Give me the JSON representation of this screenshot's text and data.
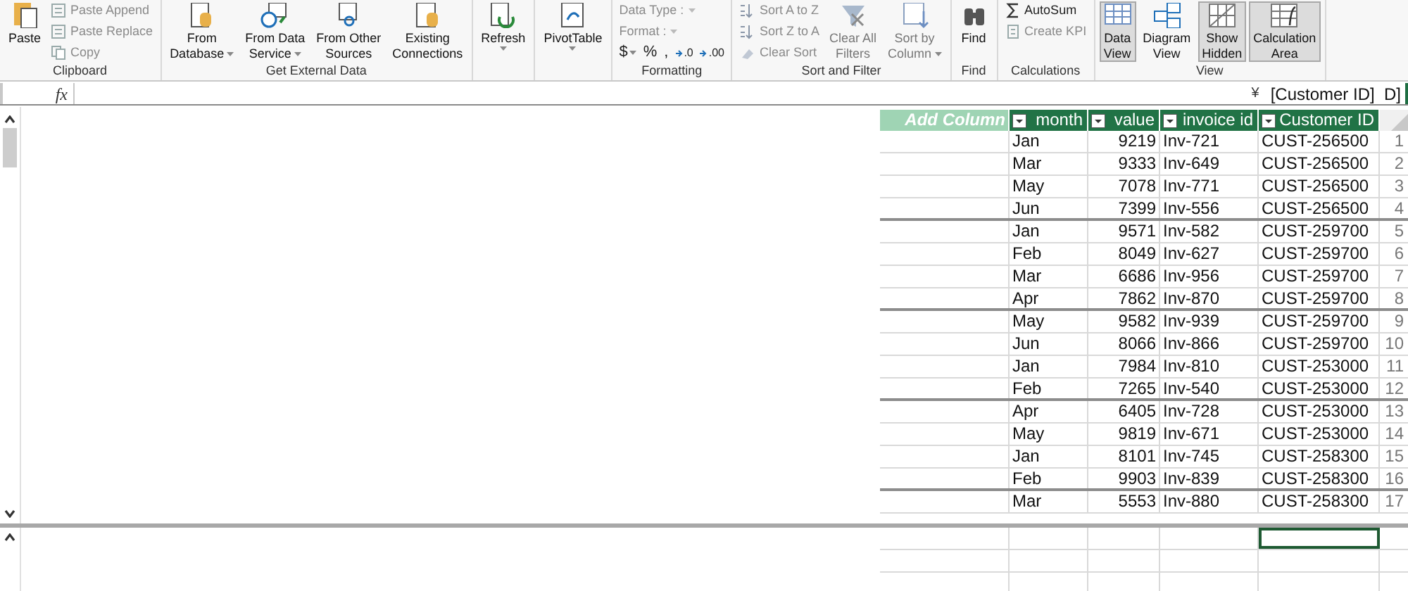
{
  "ribbon": {
    "groups": [
      {
        "label": "Clipboard",
        "items": [
          {
            "kind": "large",
            "lines": [
              "Paste"
            ],
            "dropdown": false,
            "disabled": false,
            "selected": false
          },
          {
            "kind": "stack",
            "entries": [
              {
                "label": "Paste Append",
                "disabled": true
              },
              {
                "label": "Paste Replace",
                "disabled": true
              },
              {
                "label": "Copy",
                "disabled": true
              }
            ]
          }
        ]
      },
      {
        "label": "Get External Data",
        "items": [
          {
            "kind": "large",
            "lines": [
              "From",
              "Database"
            ],
            "dropdown": true,
            "disabled": false,
            "selected": false
          },
          {
            "kind": "large",
            "lines": [
              "From Data",
              "Service"
            ],
            "dropdown": true,
            "disabled": false,
            "selected": false
          },
          {
            "kind": "large",
            "lines": [
              "From Other",
              "Sources"
            ],
            "dropdown": false,
            "disabled": false,
            "selected": false
          },
          {
            "kind": "large",
            "lines": [
              "Existing",
              "Connections"
            ],
            "dropdown": false,
            "disabled": false,
            "selected": false
          }
        ]
      },
      {
        "items": [
          {
            "kind": "large",
            "lines": [
              "Refresh"
            ],
            "dropdown": true,
            "disabled": false,
            "selected": false
          }
        ]
      },
      {
        "items": [
          {
            "kind": "large",
            "lines": [
              "PivotTable"
            ],
            "dropdown": true,
            "disabled": false,
            "selected": false
          }
        ]
      },
      {
        "label": "Formatting",
        "items": [
          {
            "kind": "stack",
            "entries": [
              {
                "label": "Data Type :",
                "disabled": true
              },
              {
                "label": "Format :",
                "disabled": true
              }
            ],
            "symbols": [
              "$",
              "%",
              ",",
              ".0",
              ".00"
            ]
          }
        ]
      },
      {
        "label": "Sort and Filter",
        "items": [
          {
            "kind": "stack",
            "entries": [
              {
                "label": "Sort A to Z",
                "disabled": true
              },
              {
                "label": "Sort Z to A",
                "disabled": true
              },
              {
                "label": "Clear Sort",
                "disabled": true
              }
            ]
          },
          {
            "kind": "large",
            "lines": [
              "Clear All",
              "Filters"
            ],
            "dropdown": false,
            "disabled": true,
            "selected": false
          },
          {
            "kind": "large",
            "lines": [
              "Sort by",
              "Column"
            ],
            "dropdown": true,
            "disabled": true,
            "selected": false
          }
        ]
      },
      {
        "label": "Find",
        "items": [
          {
            "kind": "large",
            "lines": [
              "Find"
            ],
            "dropdown": false,
            "disabled": false,
            "selected": false
          }
        ]
      },
      {
        "label": "Calculations",
        "items": [
          {
            "kind": "stack",
            "entries": [
              {
                "label": "AutoSum",
                "disabled": false
              },
              {
                "label": "Create KPI",
                "disabled": true
              }
            ]
          }
        ]
      },
      {
        "label": "View",
        "items": [
          {
            "kind": "large",
            "lines": [
              "Data",
              "View"
            ],
            "dropdown": false,
            "disabled": false,
            "selected": true
          },
          {
            "kind": "large",
            "lines": [
              "Diagram",
              "View"
            ],
            "dropdown": false,
            "disabled": false,
            "selected": false
          },
          {
            "kind": "large",
            "lines": [
              "Show",
              "Hidden"
            ],
            "dropdown": false,
            "disabled": false,
            "selected": true
          },
          {
            "kind": "large",
            "lines": [
              "Calculation",
              "Area"
            ],
            "dropdown": false,
            "disabled": false,
            "selected": true
          }
        ]
      }
    ]
  },
  "formula_bar": {
    "fx": "fx",
    "expand": "¥",
    "text": "[Customer ID]  D]"
  },
  "table": {
    "add_column": "Add Column",
    "columns": [
      "month",
      "value",
      "invoice id",
      "Customer ID"
    ],
    "rows": [
      {
        "cells": [
          "Jan",
          "9219",
          "Inv-721",
          "CUST-256500"
        ],
        "number": "1",
        "group_end": false
      },
      {
        "cells": [
          "Mar",
          "9333",
          "Inv-649",
          "CUST-256500"
        ],
        "number": "2",
        "group_end": false
      },
      {
        "cells": [
          "May",
          "7078",
          "Inv-771",
          "CUST-256500"
        ],
        "number": "3",
        "group_end": false
      },
      {
        "cells": [
          "Jun",
          "7399",
          "Inv-556",
          "CUST-256500"
        ],
        "number": "4",
        "group_end": true
      },
      {
        "cells": [
          "Jan",
          "9571",
          "Inv-582",
          "CUST-259700"
        ],
        "number": "5",
        "group_end": false
      },
      {
        "cells": [
          "Feb",
          "8049",
          "Inv-627",
          "CUST-259700"
        ],
        "number": "6",
        "group_end": false
      },
      {
        "cells": [
          "Mar",
          "6686",
          "Inv-956",
          "CUST-259700"
        ],
        "number": "7",
        "group_end": false
      },
      {
        "cells": [
          "Apr",
          "7862",
          "Inv-870",
          "CUST-259700"
        ],
        "number": "8",
        "group_end": true
      },
      {
        "cells": [
          "May",
          "9582",
          "Inv-939",
          "CUST-259700"
        ],
        "number": "9",
        "group_end": false
      },
      {
        "cells": [
          "Jun",
          "8066",
          "Inv-866",
          "CUST-259700"
        ],
        "number": "10",
        "group_end": false
      },
      {
        "cells": [
          "Jan",
          "7984",
          "Inv-810",
          "CUST-253000"
        ],
        "number": "11",
        "group_end": false
      },
      {
        "cells": [
          "Feb",
          "7265",
          "Inv-540",
          "CUST-253000"
        ],
        "number": "12",
        "group_end": true
      },
      {
        "cells": [
          "Apr",
          "6405",
          "Inv-728",
          "CUST-253000"
        ],
        "number": "13",
        "group_end": false
      },
      {
        "cells": [
          "May",
          "9819",
          "Inv-671",
          "CUST-253000"
        ],
        "number": "14",
        "group_end": false
      },
      {
        "cells": [
          "Jan",
          "8101",
          "Inv-745",
          "CUST-258300"
        ],
        "number": "15",
        "group_end": false
      },
      {
        "cells": [
          "Feb",
          "9903",
          "Inv-839",
          "CUST-258300"
        ],
        "number": "16",
        "group_end": true
      },
      {
        "cells": [
          "Mar",
          "5553",
          "Inv-880",
          "CUST-258300"
        ],
        "number": "17",
        "group_end": false
      }
    ]
  },
  "calculation_area": {
    "rows": [
      {
        "cells": [
          {
            "selected": false
          },
          {
            "selected": false
          },
          {
            "selected": false
          },
          {
            "selected": false
          },
          {
            "selected": true
          }
        ]
      },
      {
        "cells": [
          {
            "selected": false
          },
          {
            "selected": false
          },
          {
            "selected": false
          },
          {
            "selected": false
          },
          {
            "selected": false
          }
        ]
      },
      {
        "cells": [
          {
            "selected": false
          },
          {
            "selected": false
          },
          {
            "selected": false
          },
          {
            "selected": false
          },
          {
            "selected": false
          }
        ]
      }
    ]
  }
}
